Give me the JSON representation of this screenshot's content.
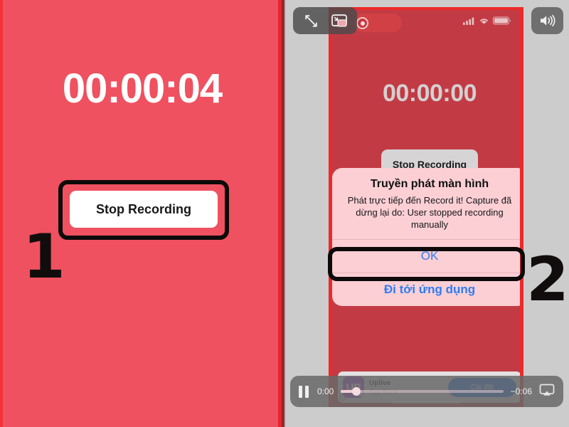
{
  "meta": {
    "left_bg": "#ef5160",
    "right_bg": "#cccccc",
    "phone_screen_bg": "#c23b44",
    "accent_red": "#ed2a2a",
    "dialog_bg": "#fbcfd4",
    "dialog_link": "#2d7cf6",
    "cta_blue": "#1367ef",
    "marker_color": "#120d0d"
  },
  "left_panel": {
    "timer": "00:00:04",
    "stop_button_label": "Stop Recording",
    "step_marker": "1"
  },
  "right_panel": {
    "step_marker": "2",
    "player_top_controls": [
      {
        "name": "expand-fullscreen-icon",
        "label": ""
      },
      {
        "name": "picture-in-picture-icon",
        "label": ""
      }
    ],
    "volume_button": {
      "name": "volume-icon",
      "label": ""
    },
    "recording_indicator": {
      "name": "record-dot-icon",
      "label": ""
    },
    "status_bar": {
      "cellular": "signal-bars-icon",
      "wifi": "wifi-icon",
      "battery": "battery-icon"
    },
    "phone": {
      "timer": "00:00:00",
      "stop_button_label": "Stop Recording"
    },
    "dialog": {
      "title": "Truyền phát màn hình",
      "message": "Phát trực tiếp đến Record it! Capture đã dừng lại do: User stopped recording manually",
      "primary_action": "OK",
      "secondary_action": "Đi tới ứng dụng"
    },
    "app_banner": {
      "app_name": "Uplive",
      "app_source": "App Store",
      "app_icon_glyph": "UP",
      "app_icon_tag": "live",
      "cta_label": "Cài đặt",
      "info_glyph": "i"
    },
    "player_bar": {
      "pause_icon": "pause-icon",
      "current_time": "0:00",
      "remaining_time": "−0:06",
      "airplay_icon": "airplay-icon"
    }
  }
}
